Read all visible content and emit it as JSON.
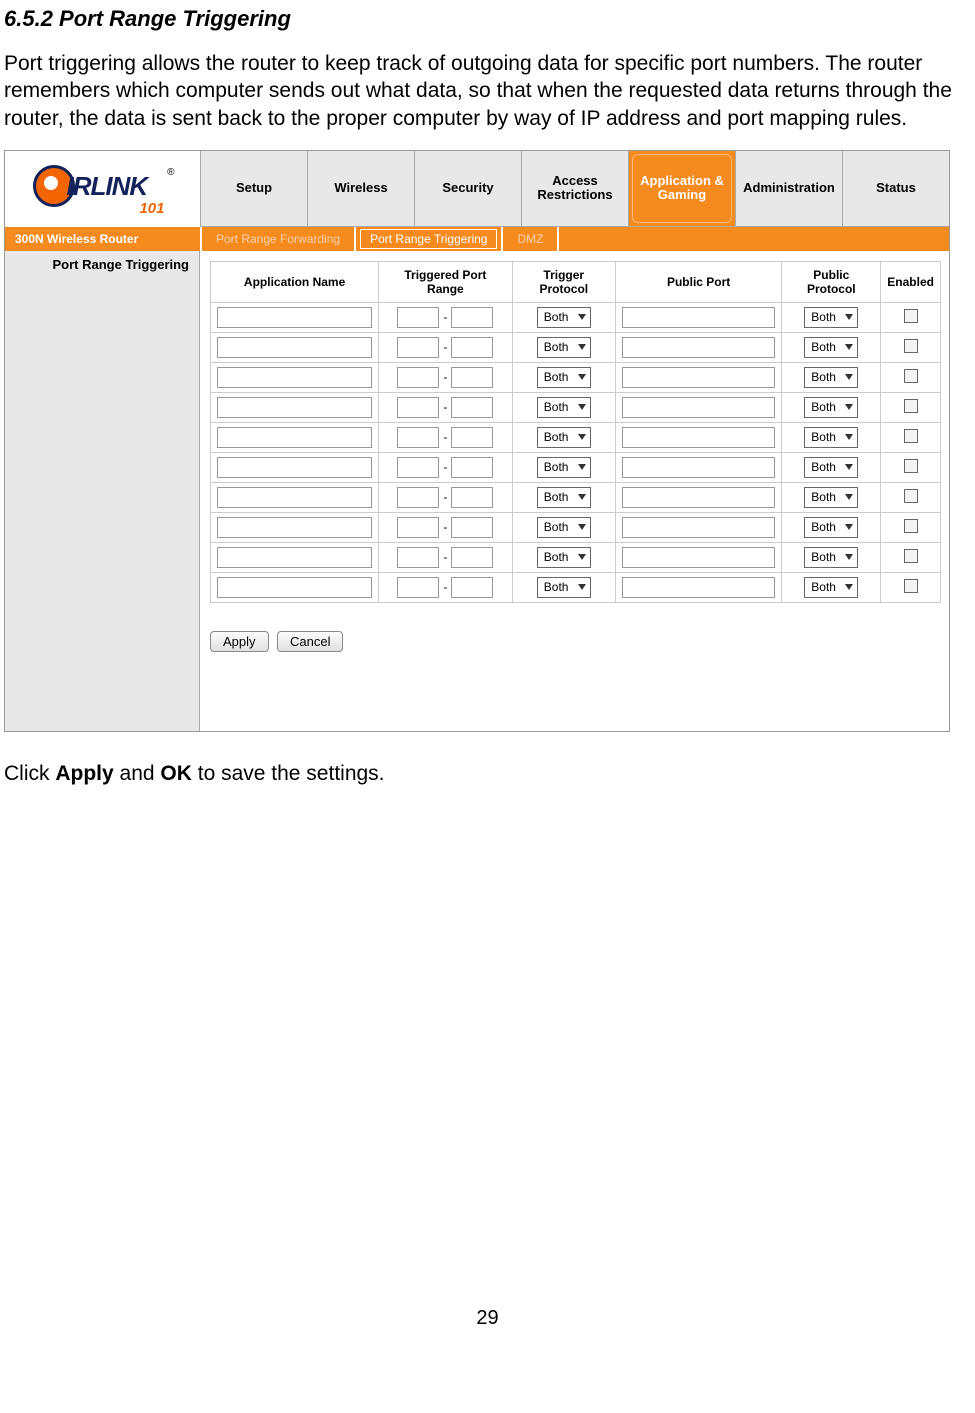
{
  "doc": {
    "heading": "6.5.2 Port Range Triggering",
    "paragraph": "Port triggering allows the router to keep track of outgoing data for specific port numbers. The router remembers which computer sends out what data, so that when the requested data returns through the router, the data is sent back to the proper computer by way of IP address and port mapping rules.",
    "closing_pre": "Click ",
    "closing_bold1": "Apply",
    "closing_mid": " and ",
    "closing_bold2": "OK",
    "closing_post": " to save the settings.",
    "page_number": "29"
  },
  "router": {
    "logo_text": "IRLINK",
    "logo_sub": "101",
    "model": "300N Wireless Router",
    "main_tabs": [
      {
        "label": "Setup",
        "active": false
      },
      {
        "label": "Wireless",
        "active": false
      },
      {
        "label": "Security",
        "active": false
      },
      {
        "label": "Access Restrictions",
        "active": false
      },
      {
        "label": "Application & Gaming",
        "active": true
      },
      {
        "label": "Administration",
        "active": false
      },
      {
        "label": "Status",
        "active": false
      }
    ],
    "sub_tabs": [
      {
        "label": "Port Range Forwarding",
        "active": false
      },
      {
        "label": "Port Range Triggering",
        "active": true
      },
      {
        "label": "DMZ",
        "active": false
      }
    ],
    "side_label": "Port Range Triggering",
    "columns": {
      "app_name": "Application Name",
      "trig_range": "Triggered Port Range",
      "trig_proto": "Trigger Protocol",
      "pub_port": "Public Port",
      "pub_proto": "Public Protocol",
      "enabled": "Enabled"
    },
    "row_defaults": {
      "trigger_protocol": "Both",
      "public_protocol": "Both"
    },
    "row_count": 10,
    "buttons": {
      "apply": "Apply",
      "cancel": "Cancel"
    }
  }
}
